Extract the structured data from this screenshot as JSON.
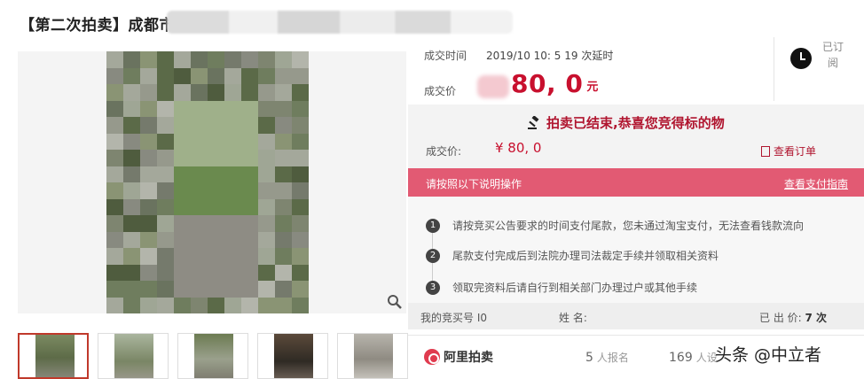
{
  "title": "【第二次拍卖】成都市",
  "deal": {
    "time_label": "成交时间",
    "time_value": "2019/10     10:   5  19 次延时",
    "price_label": "成交价",
    "price_value": "80,   0",
    "price_unit": "元"
  },
  "subscribe": {
    "label": "已订阅"
  },
  "ended": {
    "message": "拍卖已结束,恭喜您竞得标的物",
    "price_label": "成交价:",
    "price_value": "¥    80,   0",
    "view_order": "查看订单"
  },
  "guide_bar": {
    "left": "请按照以下说明操作",
    "right": "查看支付指南"
  },
  "steps": [
    {
      "num": "1",
      "text": "请按竞买公告要求的时间支付尾款，您未通过淘宝支付，无法查看钱款流向"
    },
    {
      "num": "2",
      "text": "尾款支付完成后到法院办理司法裁定手续并领取相关资料"
    },
    {
      "num": "3",
      "text": "领取完资料后请自行到相关部门办理过户或其他手续"
    }
  ],
  "my_bid": {
    "number_label": "我的竞买号 I0",
    "name_label": "姓 名: ",
    "count_label": "已 出 价: ",
    "count_value": "7 次"
  },
  "footer": {
    "logo": "阿里拍卖",
    "signup_count": "5",
    "signup_label": "人报名",
    "remind_count": "169",
    "remind_label": "人设",
    "watermark": "头条 @中立者"
  },
  "colors": {
    "accent": "#c8102e",
    "bar": "#e25a73"
  },
  "icons": [
    "gavel-icon",
    "clock-icon",
    "doc-icon",
    "zoom-icon",
    "ali-logo-icon"
  ]
}
